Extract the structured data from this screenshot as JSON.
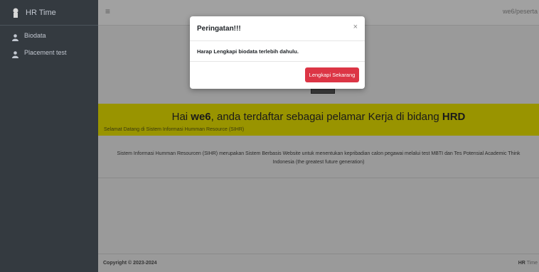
{
  "sidebar": {
    "brand": "HR Time",
    "items": [
      {
        "label": "Biodata"
      },
      {
        "label": "Placement test"
      }
    ]
  },
  "topbar": {
    "menu_glyph": "≡",
    "user": "we6/peserta"
  },
  "banner": {
    "prefix": "Hai ",
    "name": "we6",
    "middle": ", anda terdaftar sebagai pelamar Kerja di bidang ",
    "field": "HRD",
    "subtitle": "Selamat Datang di Sistem Informasi Humman Resource (SIHR)"
  },
  "description": "Sistem Informasi Humman Resourcen (SIHR) merupakan Sistem Berbasis Website untuk menentukan kepribadian calon pegawai melalui test MBTI dan Tes Potensial Academic Think Indonesia (the greatest future generation)",
  "footer": {
    "copyright": "Copyright © 2023-2024",
    "brand_bold": "HR",
    "brand_rest": " Time"
  },
  "modal": {
    "title": "Peringatan!!!",
    "close": "×",
    "message": "Harap Lengkapi biodata terlebih dahulu.",
    "button": "Lengkapi Sekarang"
  },
  "colors": {
    "sidebar": "#343a40",
    "banner": "#999400",
    "button": "#dc3545"
  }
}
